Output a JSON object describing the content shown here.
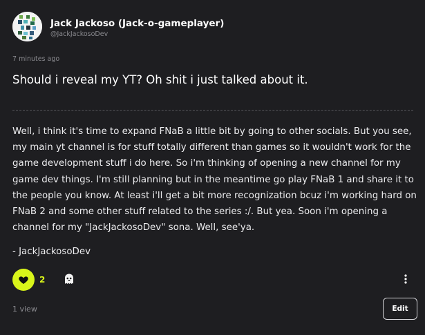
{
  "author": {
    "name": "Jack Jackoso (Jack-o-gameplayer)",
    "handle": "@JackJackosoDev",
    "avatar_icon": "pixel-art-avatar"
  },
  "post": {
    "timestamp": "7 minutes ago",
    "title": "Should i reveal my YT? Oh shit i just talked about it.",
    "body": "Well, i think it's time to expand FNaB a little bit by going to other socials. But you see, my main yt channel is for stuff totally different than games so it wouldn't work for the game development stuff i do here. So i'm thinking of opening a new channel for my game dev things. I'm still planning but in the meantime go play FNaB 1 and share it to the people you know. At least i'll get a bit more recognization bcuz i'm working hard on FNaB 2 and some other stuff related to the series :/. But yea. Soon i'm opening a channel for my \"JackJackosoDev\" sona. Well, see'ya.",
    "signature": "- JackJackosoDev"
  },
  "actions": {
    "like_count": "2",
    "like_icon": "heart-icon",
    "reaction_icon": "ghost-icon",
    "more_icon": "more-vertical-icon",
    "edit_label": "Edit"
  },
  "stats": {
    "views": "1 view"
  },
  "colors": {
    "background": "#1e1e21",
    "accent": "#d9f51a",
    "muted": "#8a8a8f"
  }
}
